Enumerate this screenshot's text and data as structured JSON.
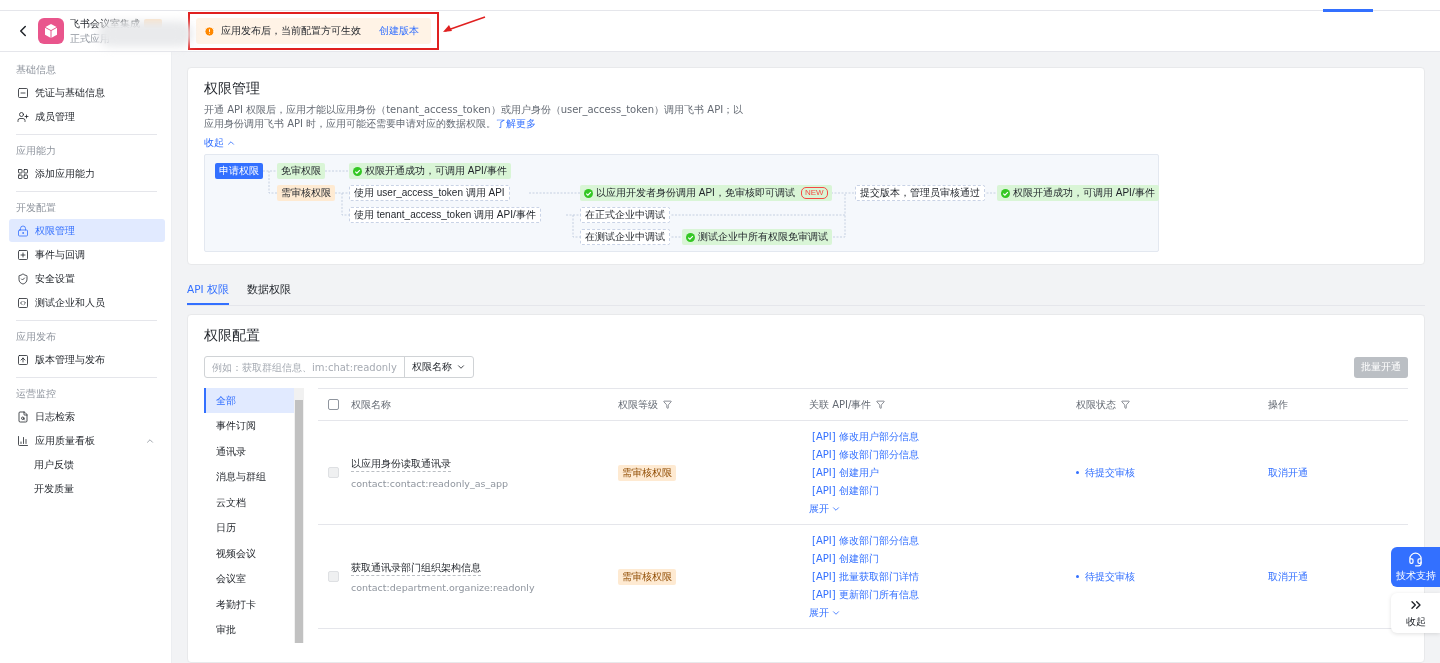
{
  "header": {
    "app_name": "飞书会议室集成",
    "app_type": "正式应用",
    "notice": {
      "text": "应用发布后，当前配置方可生效",
      "link": "创建版本"
    }
  },
  "sidebar": {
    "sections": [
      {
        "title": "基础信息",
        "items": [
          {
            "label": "凭证与基础信息",
            "selected": false
          },
          {
            "label": "成员管理",
            "selected": false
          }
        ]
      },
      {
        "title": "应用能力",
        "items": [
          {
            "label": "添加应用能力",
            "selected": false
          }
        ]
      },
      {
        "title": "开发配置",
        "items": [
          {
            "label": "权限管理",
            "selected": true
          },
          {
            "label": "事件与回调",
            "selected": false
          },
          {
            "label": "安全设置",
            "selected": false
          },
          {
            "label": "测试企业和人员",
            "selected": false
          }
        ]
      },
      {
        "title": "应用发布",
        "items": [
          {
            "label": "版本管理与发布",
            "selected": false
          }
        ]
      },
      {
        "title": "运营监控",
        "items": [
          {
            "label": "日志检索",
            "selected": false
          },
          {
            "label": "应用质量看板",
            "selected": false,
            "expanded": true,
            "children": [
              {
                "label": "用户反馈",
                "selected": false
              },
              {
                "label": "开发质量",
                "selected": false
              }
            ]
          }
        ]
      }
    ]
  },
  "intro": {
    "title": "权限管理",
    "description": "开通 API 权限后，应用才能以应用身份（tenant_access_token）或用户身份（user_access_token）调用飞书 API；以应用身份调用飞书 API 时，应用可能还需要申请对应的数据权限。",
    "learn_more": "了解更多",
    "collapse": "收起",
    "diagram": [
      {
        "kind": "start",
        "text": "申请权限"
      },
      {
        "kind": "free",
        "text": "免审权限"
      },
      {
        "kind": "success",
        "text": "权限开通成功，可调用 API/事件"
      },
      {
        "kind": "review",
        "text": "需审核权限"
      },
      {
        "kind": "step",
        "text": "使用 user_access_token 调用 API"
      },
      {
        "kind": "success",
        "text": "以应用开发者身份调用 API，免审核即可调试",
        "badge": "NEW"
      },
      {
        "kind": "step",
        "text": "提交版本，管理员审核通过"
      },
      {
        "kind": "success",
        "text": "权限开通成功，可调用 API/事件"
      },
      {
        "kind": "step",
        "text": "使用 tenant_access_token 调用 API/事件"
      },
      {
        "kind": "step",
        "text": "在正式企业中调试"
      },
      {
        "kind": "step",
        "text": "在测试企业中调试"
      },
      {
        "kind": "success",
        "text": "测试企业中所有权限免审调试"
      }
    ]
  },
  "tabs": [
    {
      "label": "API 权限",
      "selected": true
    },
    {
      "label": "数据权限",
      "selected": false
    }
  ],
  "config": {
    "title": "权限配置",
    "search": {
      "placeholder": "例如：获取群组信息、im:chat:readonly"
    },
    "search_by": "权限名称",
    "bulk_button": {
      "label": "批量开通",
      "disabled": true
    },
    "categories": [
      {
        "label": "全部",
        "selected": true
      },
      {
        "label": "事件订阅",
        "selected": false
      },
      {
        "label": "通讯录",
        "selected": false
      },
      {
        "label": "消息与群组",
        "selected": false
      },
      {
        "label": "云文档",
        "selected": false
      },
      {
        "label": "日历",
        "selected": false
      },
      {
        "label": "视频会议",
        "selected": false
      },
      {
        "label": "会议室",
        "selected": false
      },
      {
        "label": "考勤打卡",
        "selected": false
      },
      {
        "label": "审批",
        "selected": false
      }
    ],
    "table": {
      "columns": [
        {
          "label": "权限名称",
          "filter": false
        },
        {
          "label": "权限等级",
          "filter": true
        },
        {
          "label": "关联 API/事件",
          "filter": true
        },
        {
          "label": "权限状态",
          "filter": true
        },
        {
          "label": "操作",
          "filter": false
        }
      ],
      "header_checked": false,
      "rows": [
        {
          "checked": false,
          "disabled": true,
          "name": "以应用身份读取通讯录",
          "scope": "contact:contact:readonly_as_app",
          "level": "需审核权限",
          "apis": [
            "[API] 修改用户部分信息",
            "[API] 修改部门部分信息",
            "[API] 创建用户",
            "[API] 创建部门"
          ],
          "expand": "展开",
          "status": "待提交审核",
          "action": "取消开通"
        },
        {
          "checked": false,
          "disabled": true,
          "name": "获取通讯录部门组织架构信息",
          "scope": "contact:department.organize:readonly",
          "level": "需审核权限",
          "apis": [
            "[API] 修改部门部分信息",
            "[API] 创建部门",
            "[API] 批量获取部门详情",
            "[API] 更新部门所有信息"
          ],
          "expand": "展开",
          "status": "待提交审核",
          "action": "取消开通"
        }
      ]
    }
  },
  "floating": {
    "support": "技术支持",
    "collapse": "收起"
  }
}
